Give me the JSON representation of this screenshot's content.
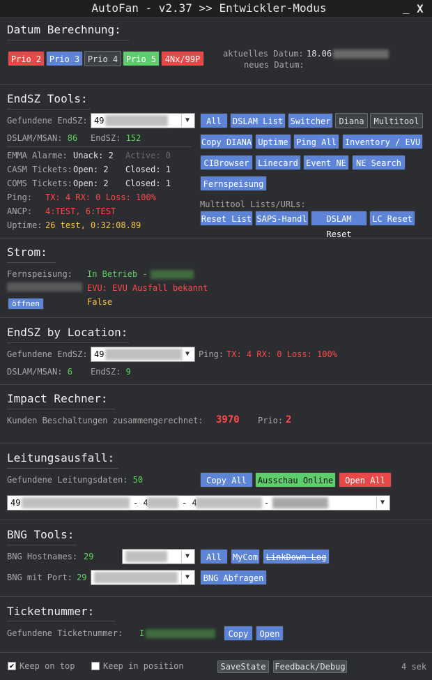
{
  "window": {
    "title": "AutoFan - v2.37 >> Entwickler-Modus",
    "minimize": "_",
    "close": "X"
  },
  "datum": {
    "header": "Datum Berechnung:",
    "prio": [
      "Prio 2",
      "Prio 3",
      "Prio 4",
      "Prio 5",
      "4Nx/99P"
    ],
    "aktuelles_label": "aktuelles Datum:",
    "aktuelles_value": "18.06",
    "neues_label": "neues Datum:"
  },
  "endsz": {
    "header": "EndSZ Tools:",
    "gefundene_label": "Gefundene EndSZ:",
    "combo_value": "49",
    "dslam_label": "DSLAM/MSAN:",
    "dslam_value": "86",
    "endsz_label": "EndSZ:",
    "endsz_value": "152",
    "emma_label": "EMMA Alarme:",
    "unack": "Unack: 2",
    "active": "Active: 0",
    "casm_label": "CASM Tickets:",
    "casm_open": "Open: 2",
    "casm_closed": "Closed: 1",
    "coms_label": "COMS Tickets:",
    "coms_open": "Open: 2",
    "coms_closed": "Closed: 1",
    "ping_label": "Ping:",
    "ping_value": "TX: 4 RX: 0 Loss: 100%",
    "ancp_label": "ANCP:",
    "ancp_value": "4:TEST, 6:TEST",
    "uptime_label": "Uptime:",
    "uptime_value": "26 test, 0:32:08.89",
    "buttons_row1": [
      "All",
      "DSLAM List",
      "Switcher",
      "Diana",
      "Multitool"
    ],
    "buttons_row2": [
      "Copy DIANA",
      "Uptime",
      "Ping All",
      "Inventory / EVU"
    ],
    "buttons_row3": [
      "CIBrowser",
      "Linecard",
      "Event NE",
      "NE Search"
    ],
    "buttons_row4": [
      "Fernspeisung"
    ],
    "multitool_label": "Multitool Lists/URLs:",
    "buttons_row5": [
      "Reset List",
      "SAPS-Handl",
      "DSLAM Reset",
      "LC Reset"
    ]
  },
  "strom": {
    "header": "Strom:",
    "fern_label": "Fernspeisung:",
    "fern_value": "In Betrieb -",
    "evu_value": "EVU: EVU Ausfall bekannt",
    "oeffnen": "öffnen",
    "false_value": "False"
  },
  "location": {
    "header": "EndSZ by Location:",
    "gefundene_label": "Gefundene EndSZ:",
    "combo_value": "49",
    "ping_label": "Ping:",
    "ping_value": "TX: 4 RX: 0 Loss: 100%",
    "dslam_label": "DSLAM/MSAN:",
    "dslam_value": "6",
    "endsz_label": "EndSZ:",
    "endsz_value": "9"
  },
  "impact": {
    "header": "Impact Rechner:",
    "kunden_label": "Kunden Beschaltungen zusammengerechnet:",
    "kunden_value": "3970",
    "prio_label": "Prio:",
    "prio_value": "2"
  },
  "leitung": {
    "header": "Leitungsausfall:",
    "label": "Gefundene Leitungsdaten:",
    "value": "50",
    "buttons": [
      "Copy All",
      "Ausschau Online",
      "Open All"
    ],
    "combo_parts": [
      "49",
      "- 4",
      "- 4",
      "-"
    ]
  },
  "bng": {
    "header": "BNG Tools:",
    "host_label": "BNG Hostnames:",
    "host_value": "29",
    "port_label": "BNG mit Port:",
    "port_value": "29",
    "buttons": [
      "All",
      "MyCom",
      "LinkDown Log"
    ],
    "abfragen": "BNG Abfragen"
  },
  "ticket": {
    "header": "Ticketnummer:",
    "label": "Gefundene Ticketnummer:",
    "value": "I",
    "buttons": [
      "Copy",
      "Open"
    ]
  },
  "footer": {
    "keep_top": "Keep on top",
    "keep_pos": "Keep in position",
    "savestate": "SaveState",
    "feedback": "Feedback/Debug",
    "timer": "4 sek"
  }
}
